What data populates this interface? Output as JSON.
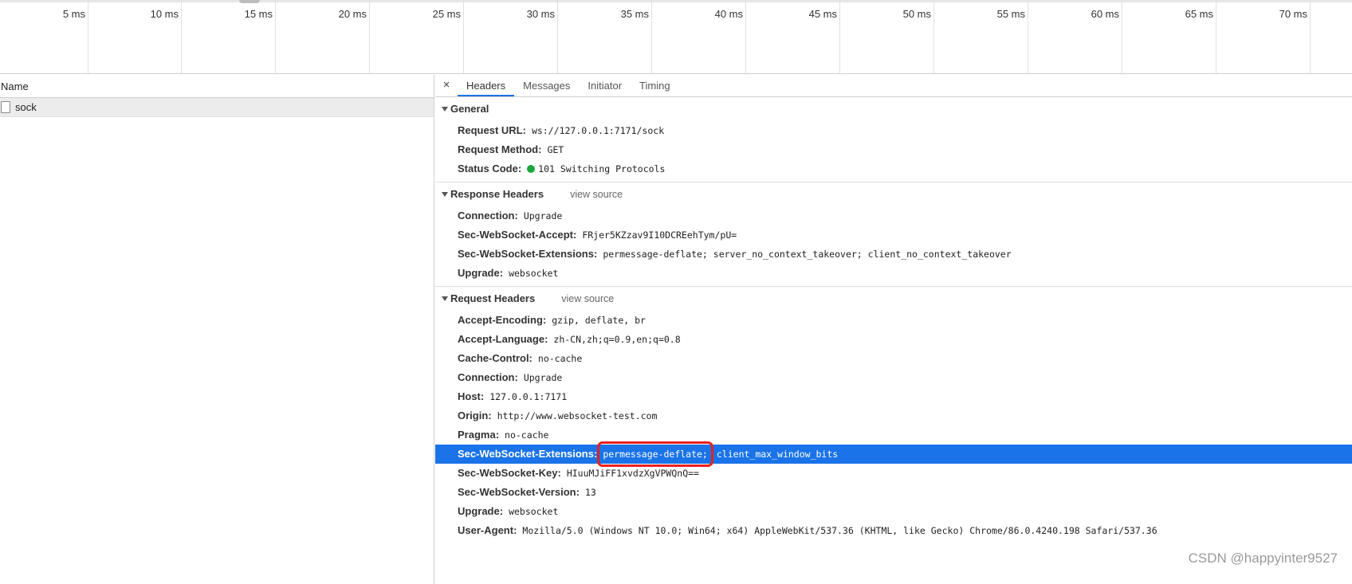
{
  "timeline": {
    "ticks": [
      "5 ms",
      "10 ms",
      "15 ms",
      "20 ms",
      "25 ms",
      "30 ms",
      "35 ms",
      "40 ms",
      "45 ms",
      "50 ms",
      "55 ms",
      "60 ms",
      "65 ms",
      "70 ms"
    ]
  },
  "left": {
    "header": "Name",
    "request_name": "sock"
  },
  "tabs": {
    "close": "×",
    "items": [
      "Headers",
      "Messages",
      "Initiator",
      "Timing"
    ],
    "active": "Headers"
  },
  "general": {
    "title": "General",
    "rows": [
      {
        "key": "Request URL:",
        "val": "ws://127.0.0.1:7171/sock"
      },
      {
        "key": "Request Method:",
        "val": "GET"
      },
      {
        "key": "Status Code:",
        "val": "101 Switching Protocols"
      }
    ],
    "status_color": "#1aa83c"
  },
  "response": {
    "title": "Response Headers",
    "view_source": "view source",
    "rows": [
      {
        "key": "Connection:",
        "val": "Upgrade"
      },
      {
        "key": "Sec-WebSocket-Accept:",
        "val": "FRjer5KZzav9I10DCREehTym/pU="
      },
      {
        "key": "Sec-WebSocket-Extensions:",
        "val": "permessage-deflate; server_no_context_takeover; client_no_context_takeover"
      },
      {
        "key": "Upgrade:",
        "val": "websocket"
      }
    ]
  },
  "request": {
    "title": "Request Headers",
    "view_source": "view source",
    "rows": [
      {
        "key": "Accept-Encoding:",
        "val": "gzip, deflate, br"
      },
      {
        "key": "Accept-Language:",
        "val": "zh-CN,zh;q=0.9,en;q=0.8"
      },
      {
        "key": "Cache-Control:",
        "val": "no-cache"
      },
      {
        "key": "Connection:",
        "val": "Upgrade"
      },
      {
        "key": "Host:",
        "val": "127.0.0.1:7171"
      },
      {
        "key": "Origin:",
        "val": "http://www.websocket-test.com"
      },
      {
        "key": "Pragma:",
        "val": "no-cache"
      }
    ],
    "highlight_row": {
      "key": "Sec-WebSocket-Extensions:",
      "val_marked": "permessage-deflate;",
      "val_rest": "client_max_window_bits"
    },
    "rows_after": [
      {
        "key": "Sec-WebSocket-Key:",
        "val": "HIuuMJiFF1xvdzXgVPWQnQ=="
      },
      {
        "key": "Sec-WebSocket-Version:",
        "val": "13"
      },
      {
        "key": "Upgrade:",
        "val": "websocket"
      },
      {
        "key": "User-Agent:",
        "val": "Mozilla/5.0 (Windows NT 10.0; Win64; x64) AppleWebKit/537.36 (KHTML, like Gecko) Chrome/86.0.4240.198 Safari/537.36"
      }
    ]
  },
  "colors": {
    "accent": "#1a73e8",
    "annotation": "#e8221b"
  },
  "watermark": "CSDN @happyinter9527"
}
